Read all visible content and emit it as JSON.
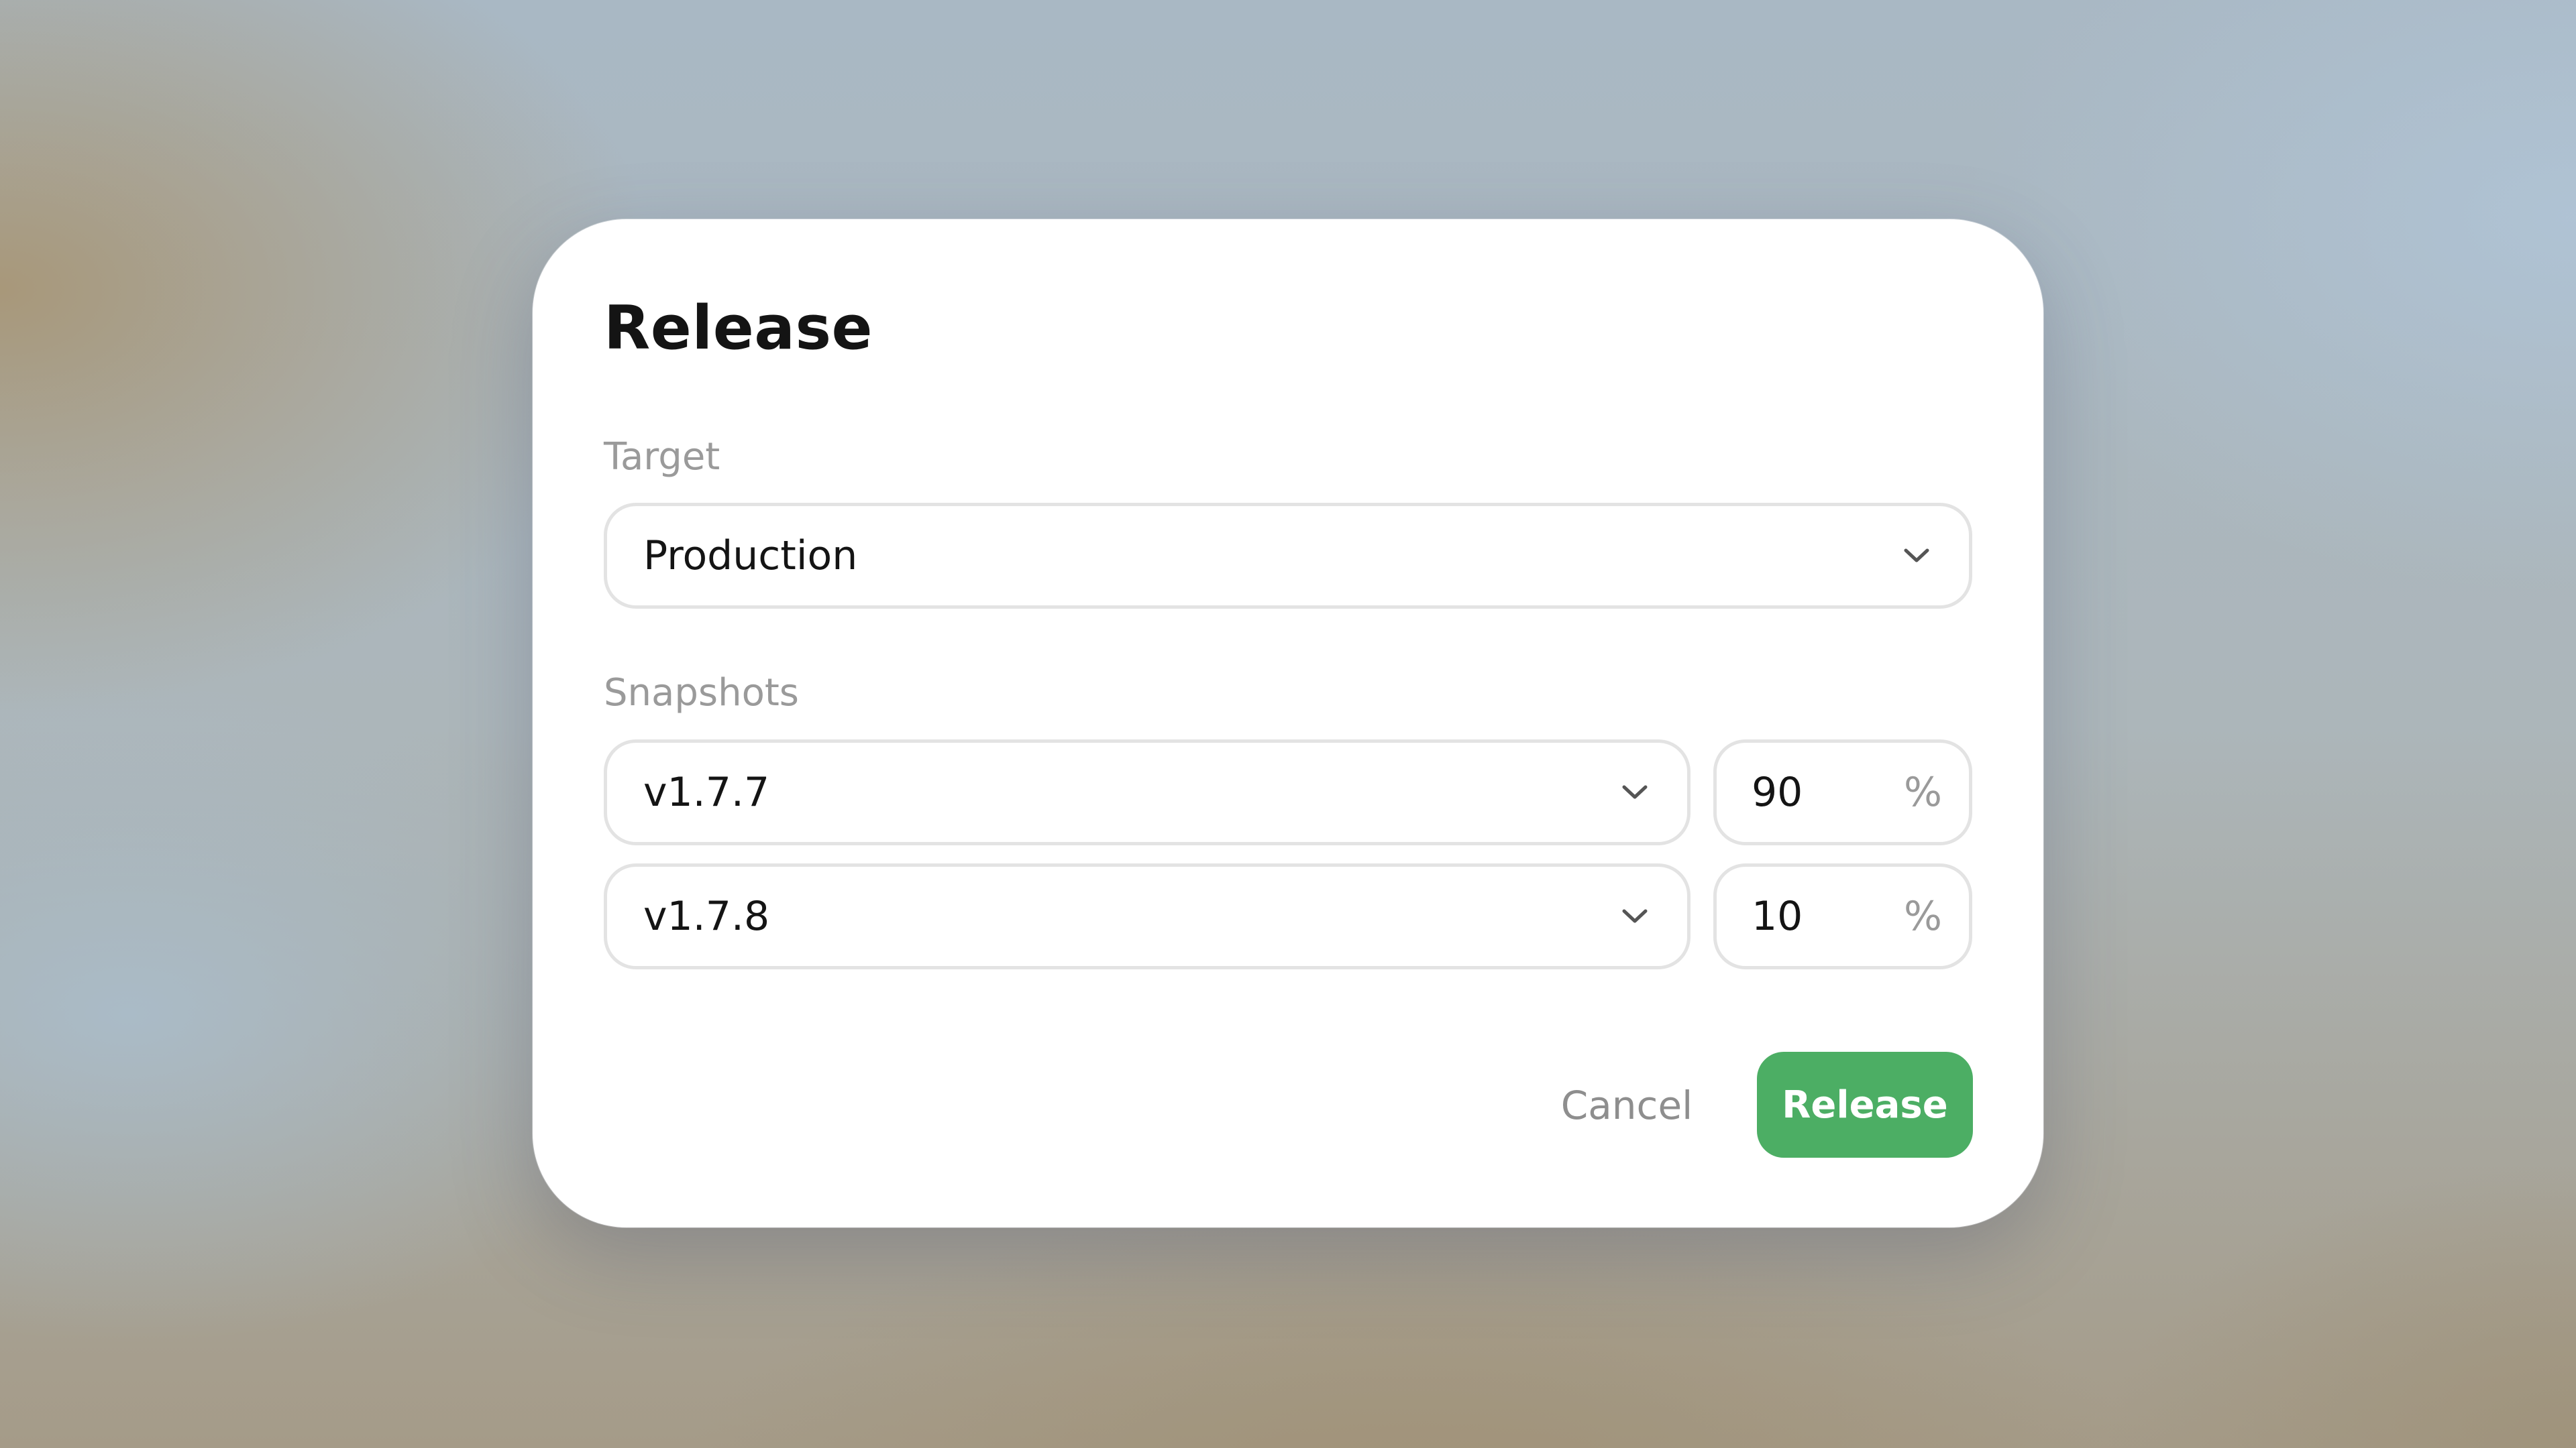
{
  "dialog": {
    "title": "Release",
    "target": {
      "label": "Target",
      "selected": "Production",
      "icon": "chevron-down-icon"
    },
    "snapshots": {
      "label": "Snapshots",
      "rows": [
        {
          "version": "v1.7.7",
          "percent": "90",
          "unit": "%"
        },
        {
          "version": "v1.7.8",
          "percent": "10",
          "unit": "%"
        }
      ]
    },
    "actions": {
      "cancel_label": "Cancel",
      "release_label": "Release"
    }
  },
  "colors": {
    "primary_button": "#4cae64",
    "muted_text": "#9a9a9a",
    "field_border": "#e3e3e3"
  }
}
